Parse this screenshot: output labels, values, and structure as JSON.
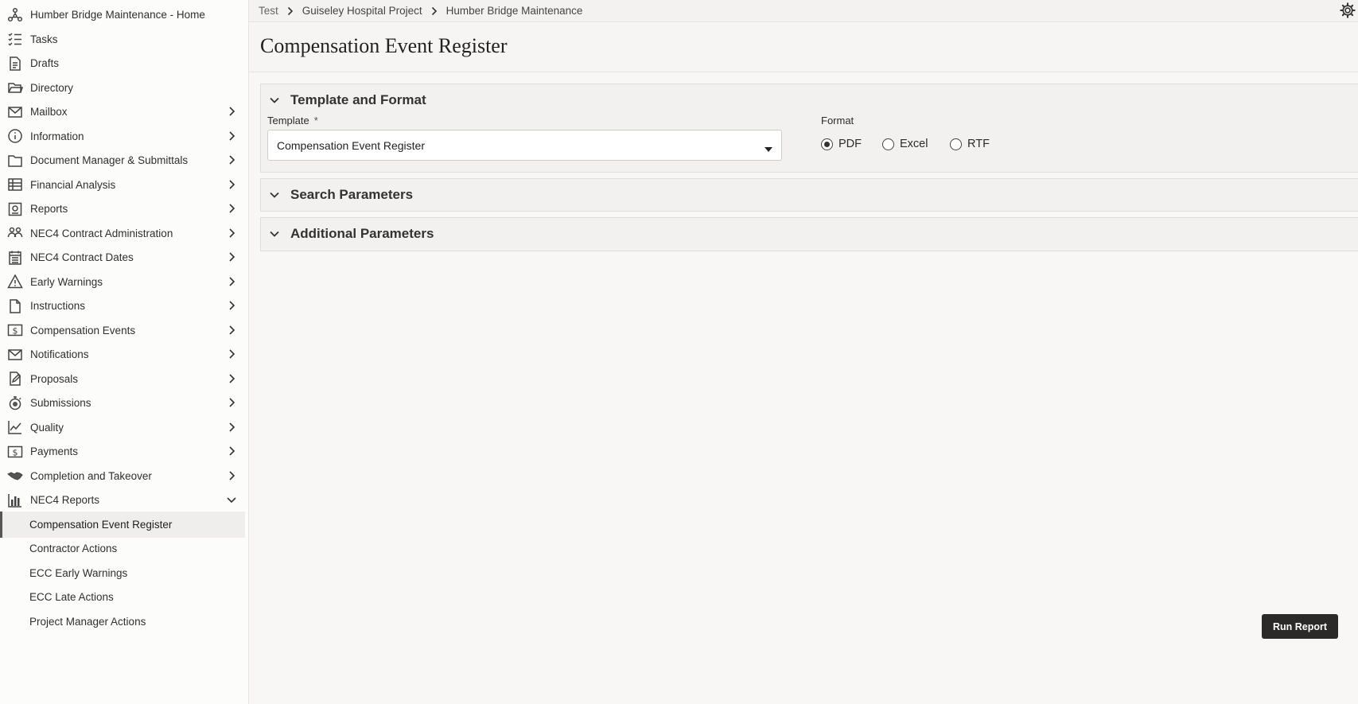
{
  "sidebar": {
    "items": [
      {
        "label": "Humber Bridge Maintenance - Home",
        "icon": "network-icon",
        "chevron": false
      },
      {
        "label": "Tasks",
        "icon": "checklist-icon",
        "chevron": false
      },
      {
        "label": "Drafts",
        "icon": "draft-document-icon",
        "chevron": false
      },
      {
        "label": "Directory",
        "icon": "folder-open-icon",
        "chevron": false
      },
      {
        "label": "Mailbox",
        "icon": "envelope-icon",
        "chevron": true
      },
      {
        "label": "Information",
        "icon": "info-icon",
        "chevron": true
      },
      {
        "label": "Document Manager & Submittals",
        "icon": "folder-icon",
        "chevron": true
      },
      {
        "label": "Financial Analysis",
        "icon": "spreadsheet-icon",
        "chevron": true
      },
      {
        "label": "Reports",
        "icon": "report-icon",
        "chevron": true
      },
      {
        "label": "NEC4 Contract Administration",
        "icon": "people-icon",
        "chevron": true
      },
      {
        "label": "NEC4 Contract Dates",
        "icon": "calendar-icon",
        "chevron": true
      },
      {
        "label": "Early Warnings",
        "icon": "warning-icon",
        "chevron": true
      },
      {
        "label": "Instructions",
        "icon": "document-icon",
        "chevron": true
      },
      {
        "label": "Compensation Events",
        "icon": "dollar-icon",
        "chevron": true
      },
      {
        "label": "Notifications",
        "icon": "envelope-icon",
        "chevron": true
      },
      {
        "label": "Proposals",
        "icon": "edit-document-icon",
        "chevron": true
      },
      {
        "label": "Submissions",
        "icon": "stopwatch-icon",
        "chevron": true
      },
      {
        "label": "Quality",
        "icon": "line-chart-icon",
        "chevron": true
      },
      {
        "label": "Payments",
        "icon": "dollar-icon",
        "chevron": true
      },
      {
        "label": "Completion and Takeover",
        "icon": "handshake-icon",
        "chevron": true
      },
      {
        "label": "NEC4 Reports",
        "icon": "bar-chart-icon",
        "chevron": "down"
      }
    ],
    "subitems": [
      {
        "label": "Compensation Event Register",
        "active": true
      },
      {
        "label": "Contractor Actions",
        "active": false
      },
      {
        "label": "ECC Early Warnings",
        "active": false
      },
      {
        "label": "ECC Late Actions",
        "active": false
      },
      {
        "label": "Project Manager Actions",
        "active": false
      }
    ]
  },
  "breadcrumb": [
    "Test",
    "Guiseley Hospital Project",
    "Humber Bridge Maintenance"
  ],
  "page": {
    "title": "Compensation Event Register"
  },
  "template_panel": {
    "title": "Template and Format",
    "template_label": "Template",
    "required_mark": "*",
    "template_value": "Compensation Event Register",
    "format_label": "Format",
    "formats": [
      {
        "label": "PDF",
        "selected": true
      },
      {
        "label": "Excel",
        "selected": false
      },
      {
        "label": "RTF",
        "selected": false
      }
    ]
  },
  "search_panel": {
    "title": "Search Parameters"
  },
  "additional_panel": {
    "title": "Additional Parameters"
  },
  "actions": {
    "run_report": "Run Report"
  },
  "colors": {
    "primary_button": "#2c2a28",
    "active_row": "#efeeec",
    "background": "#f8f7f5"
  }
}
